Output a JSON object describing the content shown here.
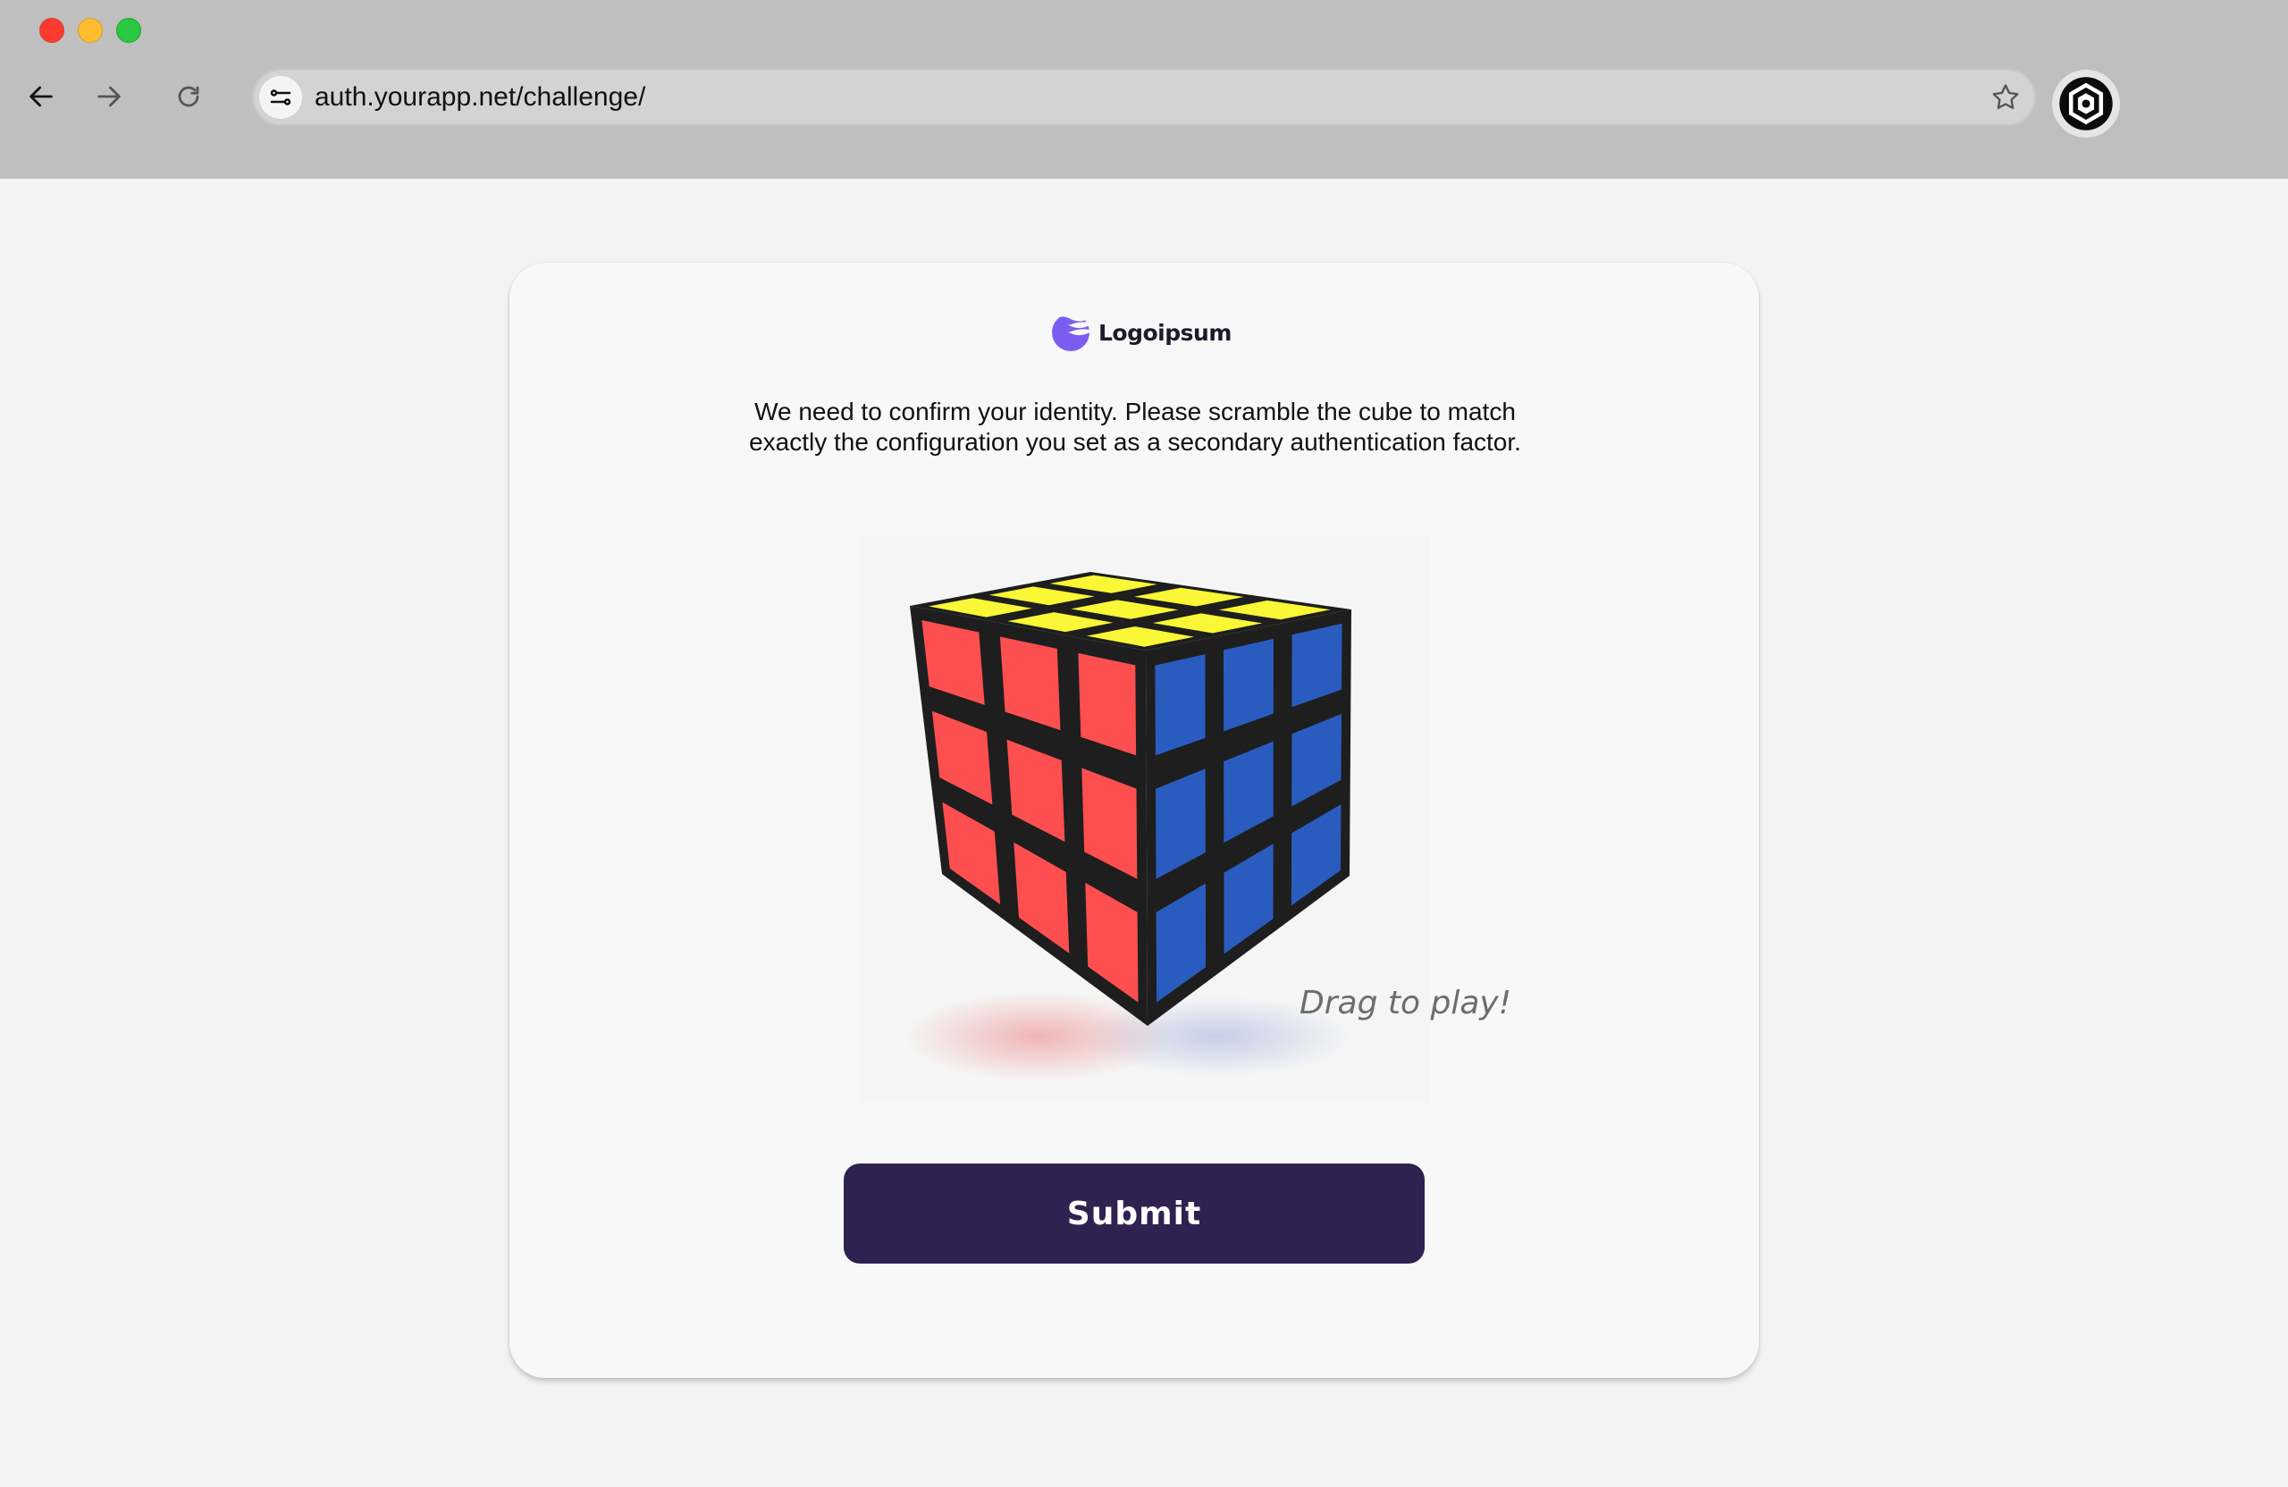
{
  "browser": {
    "url": "auth.yourapp.net/challenge/",
    "window_controls": [
      "close",
      "minimize",
      "maximize"
    ],
    "icons": {
      "back": "arrow-left-icon",
      "forward": "arrow-right-icon",
      "reload": "reload-icon",
      "site_settings": "tune-icon",
      "bookmark": "star-icon",
      "extension": "hexagon-shield-icon"
    }
  },
  "card": {
    "logo": {
      "text": "Logoipsum",
      "icon": "wave-logo-icon"
    },
    "instructions": "We need to confirm your identity. Please scramble the cube to match exactly the configuration you set as a secondary authentication factor.",
    "cube": {
      "top_face": [
        "yellow",
        "yellow",
        "yellow",
        "yellow",
        "yellow",
        "yellow",
        "yellow",
        "yellow",
        "yellow"
      ],
      "left_face": [
        "red",
        "red",
        "red",
        "red",
        "red",
        "red",
        "red",
        "red",
        "red"
      ],
      "right_face": [
        "blue",
        "blue",
        "blue",
        "blue",
        "blue",
        "blue",
        "blue",
        "blue",
        "blue"
      ],
      "colors": {
        "yellow": "#f9f736",
        "red": "#fd4f4f",
        "blue": "#2a5cbf",
        "body": "#1e1e1e"
      }
    },
    "drag_hint": "Drag to play!",
    "submit_label": "Submit",
    "accent_color": "#2f2250"
  }
}
